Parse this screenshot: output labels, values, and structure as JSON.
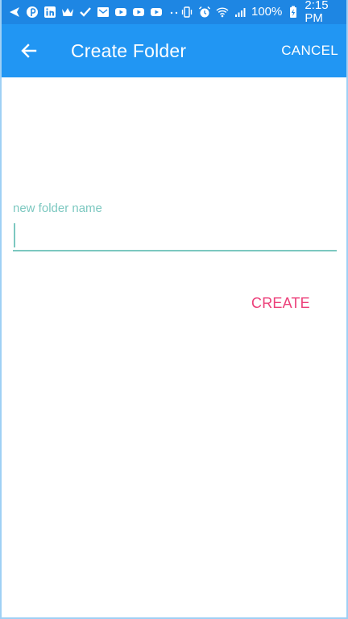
{
  "status_bar": {
    "left_icons": [
      "send-icon",
      "pinterest-icon",
      "linkedin-icon",
      "crown-icon",
      "checkmark-icon",
      "mail-icon",
      "youtube-icon",
      "youtube-icon",
      "youtube-icon",
      "more-dots-icon"
    ],
    "right_icons": [
      "vibrate-icon",
      "alarm-icon",
      "wifi-icon",
      "signal-icon",
      "battery-charging-icon"
    ],
    "battery": "100%",
    "time": "2:15 PM"
  },
  "app_bar": {
    "back_icon": "arrow-back-icon",
    "title": "Create Folder",
    "cancel_label": "CANCEL"
  },
  "form": {
    "field_label": "new folder name",
    "folder_name_value": "",
    "create_label": "CREATE"
  },
  "colors": {
    "status_bar": "#1e86e3",
    "app_bar": "#2196f3",
    "accent_teal": "#7cc8c0",
    "create_pink": "#ec407a"
  }
}
